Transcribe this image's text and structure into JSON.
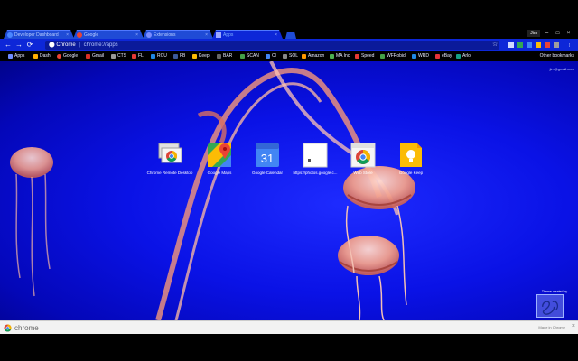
{
  "window": {
    "user": "Jim",
    "minimize": "–",
    "maximize": "□",
    "close": "×"
  },
  "tabs": [
    {
      "label": "Developer Dashboard",
      "favicon_color": "#4a86ff",
      "active": false
    },
    {
      "label": "Google",
      "favicon_color": "#ea4335",
      "active": false
    },
    {
      "label": "Extensions",
      "favicon_color": "#7a8cff",
      "active": false
    },
    {
      "label": "Apps",
      "favicon_color": "#9aa7ff",
      "active": true
    }
  ],
  "toolbar": {
    "back": "←",
    "forward": "→",
    "reload": "⟳",
    "site_label": "Chrome",
    "separator": "|",
    "url": "chrome://apps",
    "star": "☆"
  },
  "bookmarks": [
    {
      "label": "Apps",
      "color": "#6f8cff"
    },
    {
      "label": "Dash",
      "color": "#ffb000"
    },
    {
      "label": "Google",
      "color": "#ea4335"
    },
    {
      "label": "Gmail",
      "color": "#d93025"
    },
    {
      "label": "CTS",
      "color": "#999999"
    },
    {
      "label": "FL",
      "color": "#e53935"
    },
    {
      "label": "RCU",
      "color": "#1e88e5"
    },
    {
      "label": "FB",
      "color": "#3b5998"
    },
    {
      "label": "Keep",
      "color": "#fbbc05"
    },
    {
      "label": "BAR",
      "color": "#666666"
    },
    {
      "label": "SCAN",
      "color": "#43a047"
    },
    {
      "label": "Cl",
      "color": "#4285f4"
    },
    {
      "label": "SOL",
      "color": "#888888"
    },
    {
      "label": "Amazon",
      "color": "#ff9900"
    },
    {
      "label": "MA Inc",
      "color": "#4caf50"
    },
    {
      "label": "Speed",
      "color": "#e53935"
    },
    {
      "label": "WFRobid",
      "color": "#43a047"
    },
    {
      "label": "WRD",
      "color": "#1e88e5"
    },
    {
      "label": "eBay",
      "color": "#e53238"
    },
    {
      "label": "Arlo",
      "color": "#16a085"
    }
  ],
  "other_bookmarks": "Other bookmarks",
  "content": {
    "user_email": "jim@gmail.com",
    "apps": [
      {
        "label": "Chrome Remote Desktop",
        "icon": "remote-desktop-icon"
      },
      {
        "label": "Google Maps",
        "icon": "maps-icon"
      },
      {
        "label": "Google Calendar",
        "icon": "calendar-icon",
        "day": "31"
      },
      {
        "label": "https://photos.google.c...",
        "icon": "web-page-icon"
      },
      {
        "label": "Web Store",
        "icon": "web-store-icon"
      },
      {
        "label": "Google Keep",
        "icon": "keep-icon"
      }
    ],
    "theme_credit": "Theme created by"
  },
  "statusbar": {
    "label": "chrome",
    "made": "Made in Chrome",
    "close": "×"
  }
}
